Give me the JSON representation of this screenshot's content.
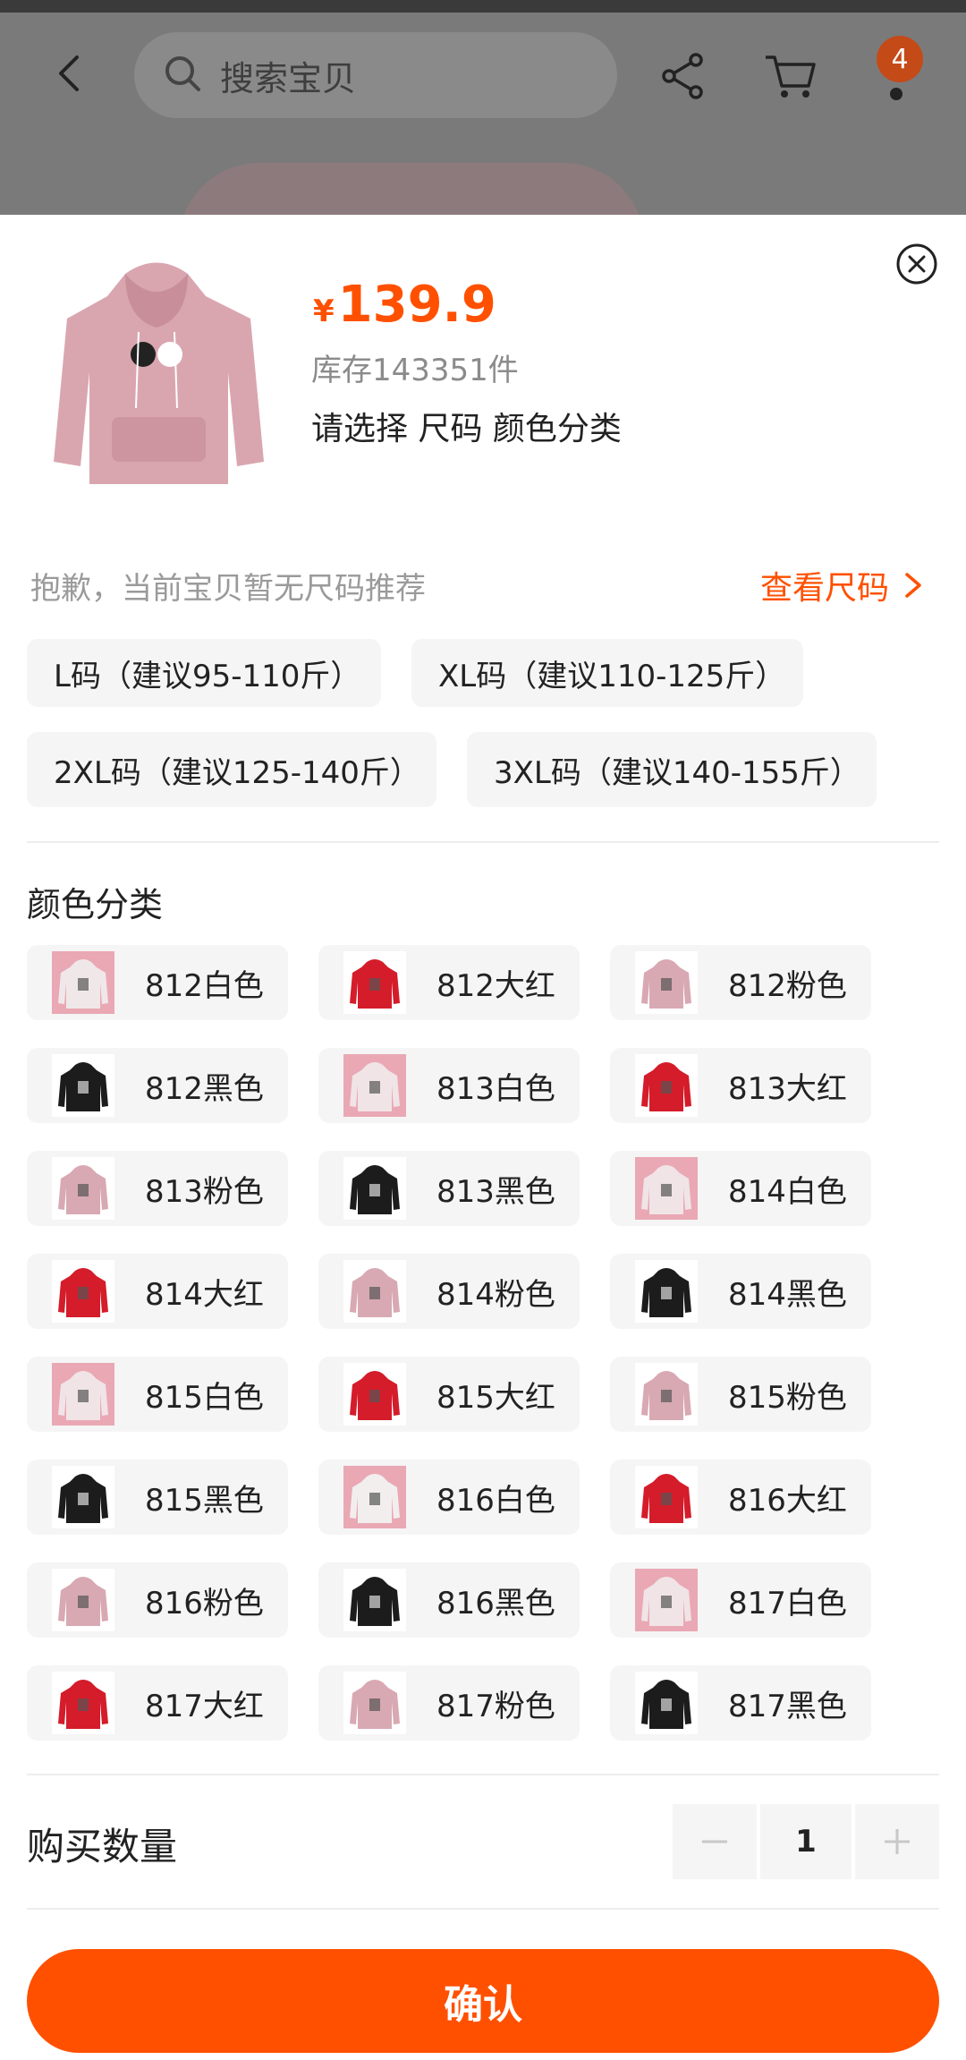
{
  "header": {
    "search_placeholder": "搜索宝贝",
    "cart_badge": "4"
  },
  "product": {
    "currency": "¥",
    "price": "139.9",
    "stock": "库存143351件",
    "select_hint": "请选择 尺码 颜色分类"
  },
  "size": {
    "note": "抱歉，当前宝贝暂无尺码推荐",
    "link": "查看尺码",
    "options": [
      "L码（建议95-110斤）",
      "XL码（建议110-125斤）",
      "2XL码（建议125-140斤）",
      "3XL码（建议140-155斤）"
    ]
  },
  "color": {
    "title": "颜色分类",
    "options": [
      {
        "label": "812白色",
        "tone": "#f0e8e8"
      },
      {
        "label": "812大红",
        "tone": "#d41c2a"
      },
      {
        "label": "812粉色",
        "tone": "#d8a9b3"
      },
      {
        "label": "812黑色",
        "tone": "#1c1c1c"
      },
      {
        "label": "813白色",
        "tone": "#f0e4e6"
      },
      {
        "label": "813大红",
        "tone": "#d41c2a"
      },
      {
        "label": "813粉色",
        "tone": "#d8a9b3"
      },
      {
        "label": "813黑色",
        "tone": "#1c1c1c"
      },
      {
        "label": "814白色",
        "tone": "#f0e4e6"
      },
      {
        "label": "814大红",
        "tone": "#d41c2a"
      },
      {
        "label": "814粉色",
        "tone": "#d8a9b3"
      },
      {
        "label": "814黑色",
        "tone": "#1c1c1c"
      },
      {
        "label": "815白色",
        "tone": "#f0e4e6"
      },
      {
        "label": "815大红",
        "tone": "#d41c2a"
      },
      {
        "label": "815粉色",
        "tone": "#d8a9b3"
      },
      {
        "label": "815黑色",
        "tone": "#1c1c1c"
      },
      {
        "label": "816白色",
        "tone": "#f2eeee"
      },
      {
        "label": "816大红",
        "tone": "#d41c2a"
      },
      {
        "label": "816粉色",
        "tone": "#d8a9b3"
      },
      {
        "label": "816黑色",
        "tone": "#1c1c1c"
      },
      {
        "label": "817白色",
        "tone": "#f0e4e6"
      },
      {
        "label": "817大红",
        "tone": "#d41c2a"
      },
      {
        "label": "817粉色",
        "tone": "#d8a9b3"
      },
      {
        "label": "817黑色",
        "tone": "#1c1c1c"
      }
    ]
  },
  "quantity": {
    "label": "购买数量",
    "value": "1"
  },
  "confirm_label": "确认",
  "colors": {
    "accent": "#ff5000",
    "chip_bg": "#f5f5f5"
  }
}
